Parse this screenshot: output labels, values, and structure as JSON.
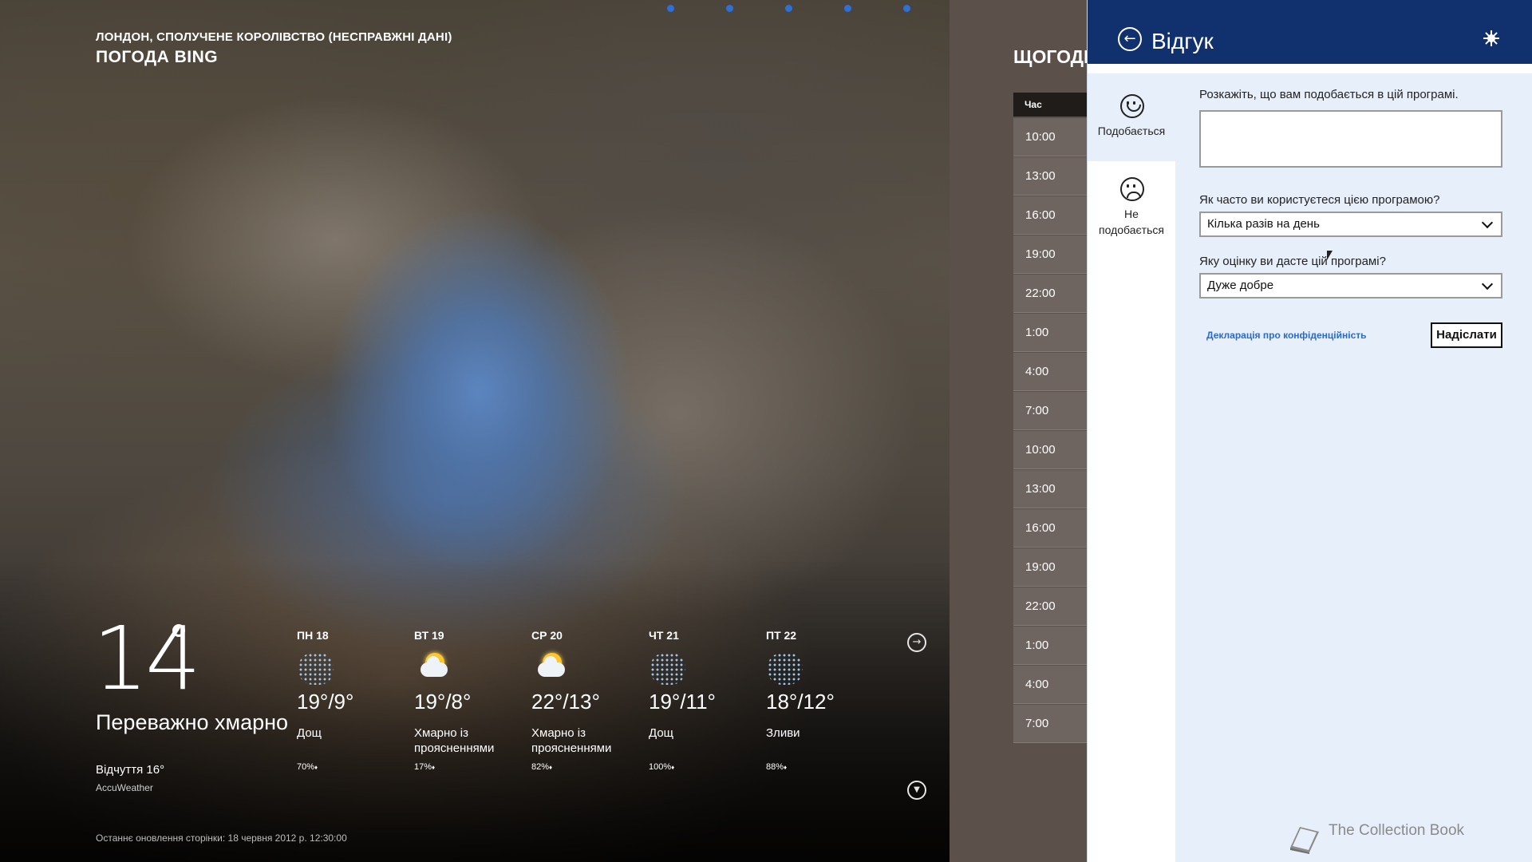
{
  "weather": {
    "location": "ЛОНДОН, СПОЛУЧЕНЕ КОРОЛІВСТВО (НЕСПРАВЖНІ ДАНІ)",
    "app_name": "ПОГОДА BING",
    "current": {
      "temperature": "14",
      "condition": "Переважно хмарно",
      "feels_like": "Відчуття 16°",
      "source": "AccuWeather"
    },
    "last_updated": "Останнє оновлення сторінки: 18 червня 2012 р. 12:30:00",
    "forecast": [
      {
        "day": "ПН 18",
        "temps": "19°/9°",
        "desc": "Дощ",
        "precip": "70%",
        "icon": "rain-icon"
      },
      {
        "day": "ВТ 19",
        "temps": "19°/8°",
        "desc": "Хмарно із проясненнями",
        "precip": "17%",
        "icon": "partly-sunny-icon"
      },
      {
        "day": "СР 20",
        "temps": "22°/13°",
        "desc": "Хмарно із проясненнями",
        "precip": "82%",
        "icon": "partly-sunny-icon"
      },
      {
        "day": "ЧТ 21",
        "temps": "19°/11°",
        "desc": "Дощ",
        "precip": "100%",
        "icon": "rain-icon"
      },
      {
        "day": "ПТ 22",
        "temps": "18°/12°",
        "desc": "Зливи",
        "precip": "88%",
        "icon": "rain-icon"
      }
    ],
    "drop_glyph": "♦",
    "next_arrow_glyph": "→",
    "expand_glyph": "▼"
  },
  "hourly": {
    "title": "ЩОГОДИ",
    "column_header": "Час",
    "times": [
      "10:00",
      "13:00",
      "16:00",
      "19:00",
      "22:00",
      "1:00",
      "4:00",
      "7:00",
      "10:00",
      "13:00",
      "16:00",
      "19:00",
      "22:00",
      "1:00",
      "4:00",
      "7:00"
    ]
  },
  "feedback": {
    "title": "Відгук",
    "back_glyph": "←",
    "nav": {
      "like_label": "Подобається",
      "dislike_label_line1": "Не",
      "dislike_label_line2": "подобається"
    },
    "prompt": "Розкажіть, що вам подобається в цій програмі.",
    "frequency_question": "Як часто ви користуєтеся цією програмою?",
    "frequency_value": "Кілька разів на день",
    "rating_question": "Яку оцінку ви дасте цій програмі?",
    "rating_value": "Дуже добре",
    "privacy_link": "Декларація про конфіденційність",
    "send_label": "Надіслати"
  },
  "watermark": "The Collection Book",
  "colors": {
    "pane_header": "#11306e",
    "pane_bg": "#e7f0fa",
    "link": "#2a6ad0",
    "nav_dots": "#2f6fd6"
  }
}
